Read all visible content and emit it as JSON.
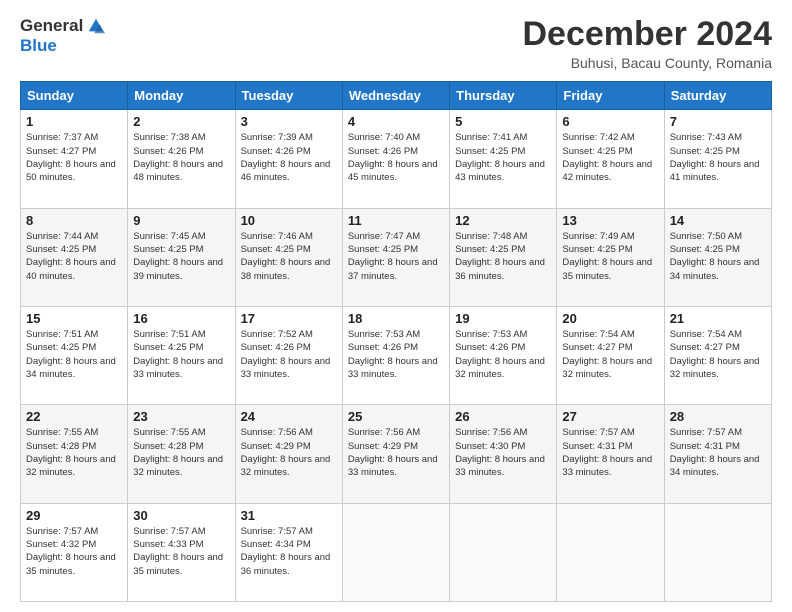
{
  "logo": {
    "general": "General",
    "blue": "Blue"
  },
  "title": "December 2024",
  "subtitle": "Buhusi, Bacau County, Romania",
  "days_of_week": [
    "Sunday",
    "Monday",
    "Tuesday",
    "Wednesday",
    "Thursday",
    "Friday",
    "Saturday"
  ],
  "weeks": [
    [
      {
        "day": "1",
        "sunrise": "Sunrise: 7:37 AM",
        "sunset": "Sunset: 4:27 PM",
        "daylight": "Daylight: 8 hours and 50 minutes."
      },
      {
        "day": "2",
        "sunrise": "Sunrise: 7:38 AM",
        "sunset": "Sunset: 4:26 PM",
        "daylight": "Daylight: 8 hours and 48 minutes."
      },
      {
        "day": "3",
        "sunrise": "Sunrise: 7:39 AM",
        "sunset": "Sunset: 4:26 PM",
        "daylight": "Daylight: 8 hours and 46 minutes."
      },
      {
        "day": "4",
        "sunrise": "Sunrise: 7:40 AM",
        "sunset": "Sunset: 4:26 PM",
        "daylight": "Daylight: 8 hours and 45 minutes."
      },
      {
        "day": "5",
        "sunrise": "Sunrise: 7:41 AM",
        "sunset": "Sunset: 4:25 PM",
        "daylight": "Daylight: 8 hours and 43 minutes."
      },
      {
        "day": "6",
        "sunrise": "Sunrise: 7:42 AM",
        "sunset": "Sunset: 4:25 PM",
        "daylight": "Daylight: 8 hours and 42 minutes."
      },
      {
        "day": "7",
        "sunrise": "Sunrise: 7:43 AM",
        "sunset": "Sunset: 4:25 PM",
        "daylight": "Daylight: 8 hours and 41 minutes."
      }
    ],
    [
      {
        "day": "8",
        "sunrise": "Sunrise: 7:44 AM",
        "sunset": "Sunset: 4:25 PM",
        "daylight": "Daylight: 8 hours and 40 minutes."
      },
      {
        "day": "9",
        "sunrise": "Sunrise: 7:45 AM",
        "sunset": "Sunset: 4:25 PM",
        "daylight": "Daylight: 8 hours and 39 minutes."
      },
      {
        "day": "10",
        "sunrise": "Sunrise: 7:46 AM",
        "sunset": "Sunset: 4:25 PM",
        "daylight": "Daylight: 8 hours and 38 minutes."
      },
      {
        "day": "11",
        "sunrise": "Sunrise: 7:47 AM",
        "sunset": "Sunset: 4:25 PM",
        "daylight": "Daylight: 8 hours and 37 minutes."
      },
      {
        "day": "12",
        "sunrise": "Sunrise: 7:48 AM",
        "sunset": "Sunset: 4:25 PM",
        "daylight": "Daylight: 8 hours and 36 minutes."
      },
      {
        "day": "13",
        "sunrise": "Sunrise: 7:49 AM",
        "sunset": "Sunset: 4:25 PM",
        "daylight": "Daylight: 8 hours and 35 minutes."
      },
      {
        "day": "14",
        "sunrise": "Sunrise: 7:50 AM",
        "sunset": "Sunset: 4:25 PM",
        "daylight": "Daylight: 8 hours and 34 minutes."
      }
    ],
    [
      {
        "day": "15",
        "sunrise": "Sunrise: 7:51 AM",
        "sunset": "Sunset: 4:25 PM",
        "daylight": "Daylight: 8 hours and 34 minutes."
      },
      {
        "day": "16",
        "sunrise": "Sunrise: 7:51 AM",
        "sunset": "Sunset: 4:25 PM",
        "daylight": "Daylight: 8 hours and 33 minutes."
      },
      {
        "day": "17",
        "sunrise": "Sunrise: 7:52 AM",
        "sunset": "Sunset: 4:26 PM",
        "daylight": "Daylight: 8 hours and 33 minutes."
      },
      {
        "day": "18",
        "sunrise": "Sunrise: 7:53 AM",
        "sunset": "Sunset: 4:26 PM",
        "daylight": "Daylight: 8 hours and 33 minutes."
      },
      {
        "day": "19",
        "sunrise": "Sunrise: 7:53 AM",
        "sunset": "Sunset: 4:26 PM",
        "daylight": "Daylight: 8 hours and 32 minutes."
      },
      {
        "day": "20",
        "sunrise": "Sunrise: 7:54 AM",
        "sunset": "Sunset: 4:27 PM",
        "daylight": "Daylight: 8 hours and 32 minutes."
      },
      {
        "day": "21",
        "sunrise": "Sunrise: 7:54 AM",
        "sunset": "Sunset: 4:27 PM",
        "daylight": "Daylight: 8 hours and 32 minutes."
      }
    ],
    [
      {
        "day": "22",
        "sunrise": "Sunrise: 7:55 AM",
        "sunset": "Sunset: 4:28 PM",
        "daylight": "Daylight: 8 hours and 32 minutes."
      },
      {
        "day": "23",
        "sunrise": "Sunrise: 7:55 AM",
        "sunset": "Sunset: 4:28 PM",
        "daylight": "Daylight: 8 hours and 32 minutes."
      },
      {
        "day": "24",
        "sunrise": "Sunrise: 7:56 AM",
        "sunset": "Sunset: 4:29 PM",
        "daylight": "Daylight: 8 hours and 32 minutes."
      },
      {
        "day": "25",
        "sunrise": "Sunrise: 7:56 AM",
        "sunset": "Sunset: 4:29 PM",
        "daylight": "Daylight: 8 hours and 33 minutes."
      },
      {
        "day": "26",
        "sunrise": "Sunrise: 7:56 AM",
        "sunset": "Sunset: 4:30 PM",
        "daylight": "Daylight: 8 hours and 33 minutes."
      },
      {
        "day": "27",
        "sunrise": "Sunrise: 7:57 AM",
        "sunset": "Sunset: 4:31 PM",
        "daylight": "Daylight: 8 hours and 33 minutes."
      },
      {
        "day": "28",
        "sunrise": "Sunrise: 7:57 AM",
        "sunset": "Sunset: 4:31 PM",
        "daylight": "Daylight: 8 hours and 34 minutes."
      }
    ],
    [
      {
        "day": "29",
        "sunrise": "Sunrise: 7:57 AM",
        "sunset": "Sunset: 4:32 PM",
        "daylight": "Daylight: 8 hours and 35 minutes."
      },
      {
        "day": "30",
        "sunrise": "Sunrise: 7:57 AM",
        "sunset": "Sunset: 4:33 PM",
        "daylight": "Daylight: 8 hours and 35 minutes."
      },
      {
        "day": "31",
        "sunrise": "Sunrise: 7:57 AM",
        "sunset": "Sunset: 4:34 PM",
        "daylight": "Daylight: 8 hours and 36 minutes."
      },
      null,
      null,
      null,
      null
    ]
  ]
}
